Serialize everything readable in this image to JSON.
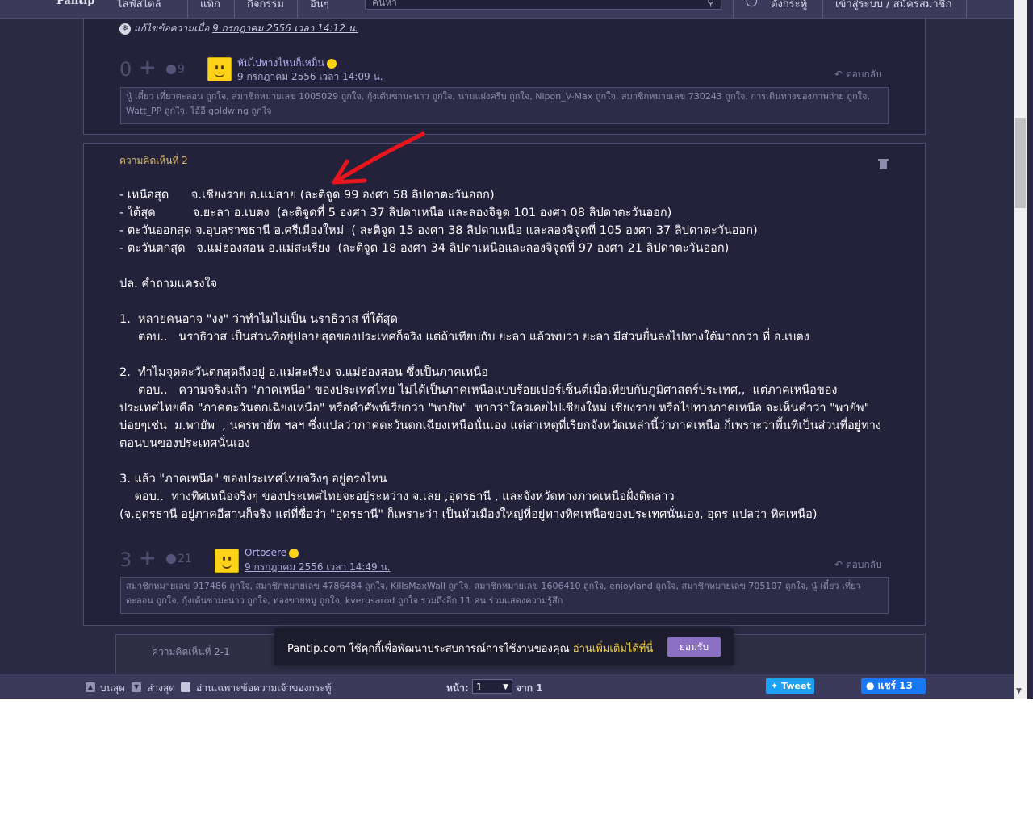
{
  "topnav": {
    "logo": "Pantip",
    "items": [
      "ไลฟ์สไตล์",
      "แท็ก",
      "กิจกรรม",
      "อื่นๆ"
    ],
    "search_placeholder": "ค้นหา",
    "right_items": [
      "ตั้งกระทู้",
      "เข้าสู่ระบบ / สมัครสมาชิก"
    ]
  },
  "comment1": {
    "edited_prefix": "แก้ไขข้อความเมื่อ",
    "edited_time": "9 กรกฎาคม 2556 เวลา 14:12 น.",
    "votes": "0",
    "emotions": "9",
    "author": "หันไปทางไหนก็เหม็น",
    "time": "9 กรกฎาคม 2556 เวลา 14:09 น.",
    "reply": "ตอบกลับ",
    "likes": "นู๋ เดี๋ยว เที่ยวตะลอน ถูกใจ, สมาชิกหมายเลข 1005029 ถูกใจ, กุ้งเต้นซามะนาว ถูกใจ, นามแฝงครีบ ถูกใจ, Nipon_V-Max ถูกใจ, สมาชิกหมายเลข 730243 ถูกใจ, การเดินทางของภาพถ่าย ถูกใจ, Watt_PP ถูกใจ, ไอ้อี goldwing ถูกใจ"
  },
  "comment2": {
    "label": "ความคิดเห็นที่ 2",
    "body": "- เหนือสุด      จ.เชียงราย อ.แม่สาย (ละติจูด 99 องศา 58 ลิปดาตะวันออก)\n- ใต้สุด          จ.ยะลา อ.เบตง  (ละติจูดที่ 5 องศา 37 ลิปดาเหนือ และลองจิจูด 101 องศา 08 ลิปดาตะวันออก)\n- ตะวันออกสุด จ.อุบลราชธานี อ.ศรีเมืองใหม่  ( ละติจูด 15 องศา 38 ลิปดาเหนือ และลองจิจูดที่ 105 องศา 37 ลิปดาตะวันออก)\n- ตะวันตกสุด   จ.แม่ฮ่องสอน อ.แม่สะเรียง  (ละติจูด 18 องศา 34 ลิปดาเหนือและลองจิจูดที่ 97 องศา 21 ลิปดาตะวันออก)\n\nปล. คำถามแครงใจ\n\n1.  หลายคนอาจ \"งง\" ว่าทำไมไม่เป็น นราธิวาส ที่ใต้สุด\n     ตอบ..   นราธิวาส เป็นส่วนที่อยู่ปลายสุดของประเทศก็จริง แต่ถ้าเทียบกับ ยะลา แล้วพบว่า ยะลา มีส่วนยื่นลงไปทางใต้มากกว่า ที่ อ.เบตง\n\n2.  ทำไมจุดตะวันตกสุดถึงอยู่ อ.แม่สะเรียง จ.แม่ฮ่องสอน ซึ่งเป็นภาคเหนือ\n     ตอบ..   ความจริงแล้ว \"ภาคเหนือ\" ของประเทศไทย ไม่ได้เป็นภาคเหนือแบบร้อยเปอร์เซ็นต์เมื่อเทียบกับภูมิศาสตร์ประเทศ,,  แต่ภาคเหนือของประเทศไทยคือ \"ภาคตะวันตกเฉียงเหนือ\" หรือคำศัพท์เรียกว่า \"พายัพ\"  หากว่าใครเคยไปเชียงใหม่ เชียงราย หรือไปทางภาคเหนือ จะเห็นคำว่า \"พายัพ\" บ่อยๆเช่น  ม.พายัพ  , นครพายัพ ฯลฯ ซึ่งแปลว่าภาคตะวันตกเฉียงเหนือนั่นเอง แต่สาเหตุที่เรียกจังหวัดเหล่านี้ว่าภาคเหนือ ก็เพราะว่าพื้นที่เป็นส่วนที่อยู่ทางตอนบนของประเทศนั่นเอง\n\n3. แล้ว \"ภาคเหนือ\" ของประเทศไทยจริงๆ อยู่ตรงไหน\n    ตอบ..  ทางทิศเหนือจริงๆ ของประเทศไทยจะอยู่ระหว่าง จ.เลย ,อุดรธานี , และจังหวัดทางภาคเหนือฝั่งติดลาว\n(จ.อุดรธานี อยู่ภาคอีสานก็จริง แต่ที่ชื่อว่า \"อุดรธานี\" ก็เพราะว่า เป็นหัวเมืองใหญ่ที่อยู่ทางทิศเหนือของประเทศนั่นเอง, อุดร แปลว่า ทิศเหนือ)",
    "votes": "3",
    "emotions": "21",
    "author": "Ortosere",
    "time": "9 กรกฎาคม 2556 เวลา 14:49 น.",
    "reply": "ตอบกลับ",
    "likes": "สมาชิกหมายเลข 917486 ถูกใจ, สมาชิกหมายเลข 4786484 ถูกใจ, KillsMaxWall ถูกใจ, สมาชิกหมายเลข 1606410 ถูกใจ, enjoyland ถูกใจ, สมาชิกหมายเลข 705107 ถูกใจ, นู๋ เดี๋ยว เที่ยวตะลอน ถูกใจ, กุ้งเต้นซามะนาว ถูกใจ, ทองขายหมู ถูกใจ, kverusarod ถูกใจ รวมถึงอีก 11 คน ร่วมแสดงความรู้สึก"
  },
  "subcomment": {
    "label": "ความคิดเห็นที่ 2-1"
  },
  "cookie": {
    "message": "Pantip.com ใช้คุกกี้เพื่อพัฒนาประสบการณ์การใช้งานของคุณ",
    "more": "อ่านเพิ่มเติมได้ที่นี่",
    "accept": "ยอมรับ"
  },
  "bottombar": {
    "top": "บนสุด",
    "bottom": "ล่างสุด",
    "owner_only": "อ่านเฉพาะข้อความเจ้าของกระทู้",
    "page_label": "หน้า:",
    "page_value": "1",
    "of_label": "จาก 1",
    "tweet": "Tweet",
    "share": "แชร์ 13"
  }
}
